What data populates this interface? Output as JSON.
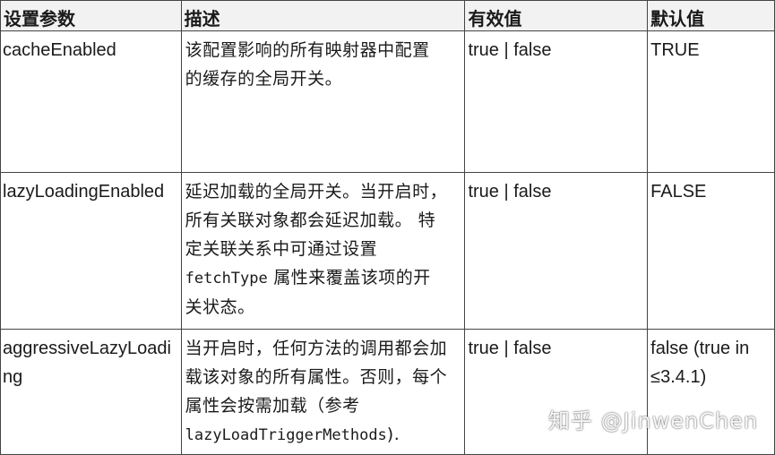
{
  "headers": [
    "设置参数",
    "描述",
    "有效值",
    "默认值"
  ],
  "rows": [
    {
      "name": "cacheEnabled",
      "desc_lines": [
        "该配置影响的所有映射器中配置",
        "的缓存的全局开关。"
      ],
      "valid": "true | false",
      "default": "TRUE"
    },
    {
      "name": "lazyLoadingEnabled",
      "desc_lines": [
        "延迟加载的全局开关。当开启时，",
        "所有关联对象都会延迟加载。 特",
        "定关联关系中可通过设置"
      ],
      "desc_code": "fetchType",
      "desc_after_code": " 属性来覆盖该项的开",
      "desc_last": "关状态。",
      "valid": "true | false",
      "default": "FALSE"
    },
    {
      "name": "aggressiveLazyLoading",
      "desc_lines": [
        "当开启时，任何方法的调用都会加",
        "载该对象的所有属性。否则，每个",
        "属性会按需加载（参考"
      ],
      "desc_code": "lazyLoadTriggerMethods",
      "desc_after_code": ").",
      "valid": "true | false",
      "default": "false (true in ≤3.4.1)"
    }
  ],
  "watermark": "知乎 @JinwenChen"
}
